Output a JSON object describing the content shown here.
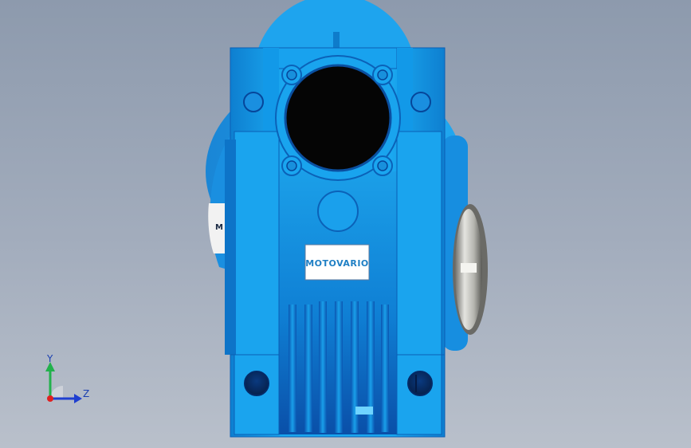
{
  "scene": {
    "type": "cad-3d-viewport",
    "background_top": "#8d9aad",
    "background_bottom": "#b9c0cb"
  },
  "model": {
    "body_color": "#1aa8f0",
    "body_shadow": "#0d6fc0",
    "bore_color": "#0a0a0a",
    "flange_color": "#c8c8c4",
    "nameplate": {
      "brand": "MOTOVARIO",
      "side_label": "M"
    }
  },
  "triad": {
    "y_label": "Y",
    "z_label": "Z",
    "y_color": "#22b14c",
    "z_color": "#1f3fd0",
    "origin_color": "#e02020"
  }
}
